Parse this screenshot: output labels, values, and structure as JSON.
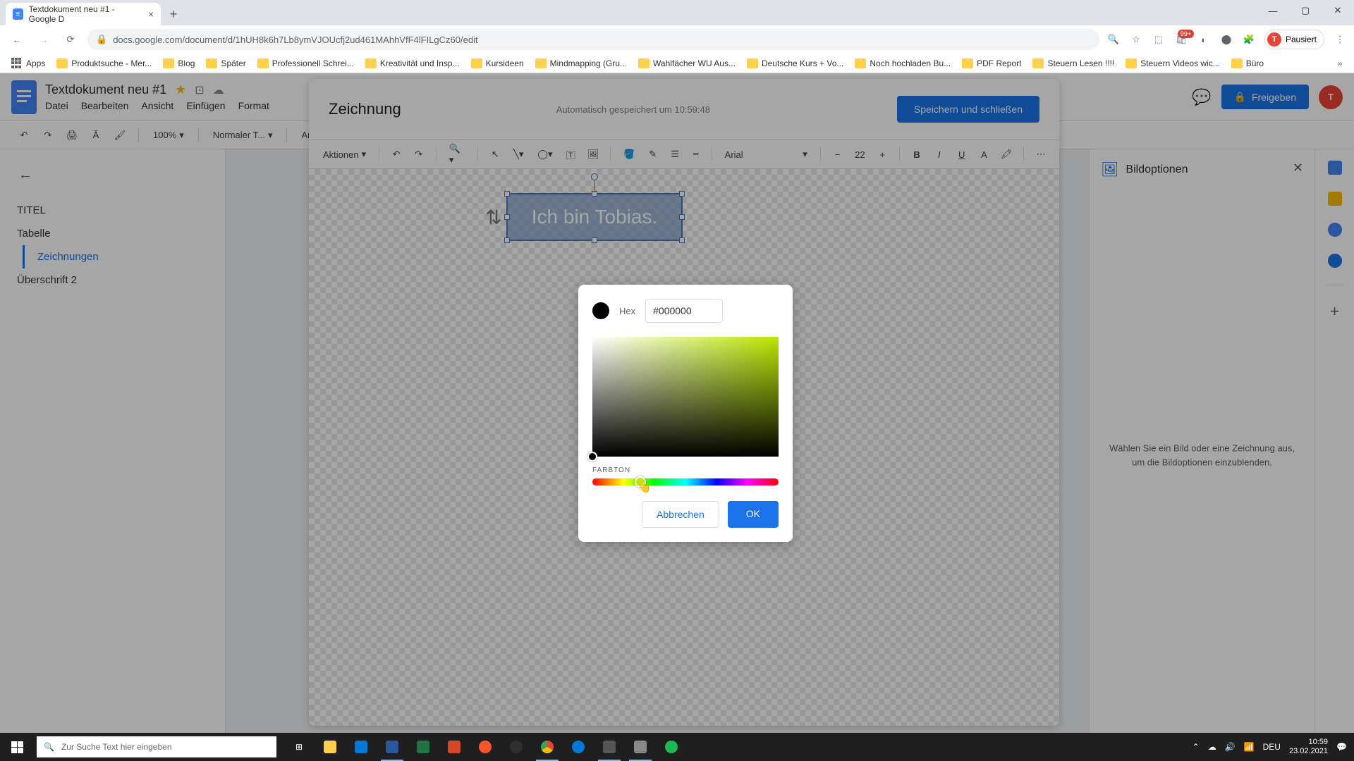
{
  "browser": {
    "tab_title": "Textdokument neu #1 - Google D",
    "url": "docs.google.com/document/d/1hUH8k6h7Lb8ymVJOUcfj2ud461MAhhVfF4lFILgCz60/edit",
    "profile_status": "Pausiert",
    "bookmarks": [
      "Apps",
      "Produktsuche - Mer...",
      "Blog",
      "Später",
      "Professionell Schrei...",
      "Kreativität und Insp...",
      "Kursideen",
      "Mindmapping  (Gru...",
      "Wahlfächer WU Aus...",
      "Deutsche Kurs + Vo...",
      "Noch hochladen Bu...",
      "PDF Report",
      "Steuern Lesen !!!!",
      "Steuern Videos wic...",
      "Büro"
    ]
  },
  "docs": {
    "title": "Textdokument neu #1",
    "menus": [
      "Datei",
      "Bearbeiten",
      "Ansicht",
      "Einfügen",
      "Format"
    ],
    "zoom": "100%",
    "style": "Normaler T...",
    "font_partial": "Ari",
    "share": "Freigeben",
    "outline": {
      "items": [
        "TITEL",
        "Tabelle",
        "Zeichnungen",
        "Überschrift 2"
      ]
    },
    "right_panel": {
      "title": "Bildoptionen",
      "message": "Wählen Sie ein Bild oder eine Zeichnung aus, um die Bildoptionen einzublenden."
    }
  },
  "drawing": {
    "title": "Zeichnung",
    "autosave": "Automatisch gespeichert um 10:59:48",
    "save_close": "Speichern und schließen",
    "actions": "Aktionen",
    "font": "Arial",
    "font_size": "22",
    "textbox_text": "Ich bin Tobias."
  },
  "color_picker": {
    "hex_label": "Hex",
    "hex_value": "#000000",
    "hue_label": "FARBTON",
    "cancel": "Abbrechen",
    "ok": "OK"
  },
  "taskbar": {
    "search_placeholder": "Zur Suche Text hier eingeben",
    "extension_count": "99+",
    "lang": "DEU",
    "time": "10:59",
    "date": "23.02.2021"
  }
}
